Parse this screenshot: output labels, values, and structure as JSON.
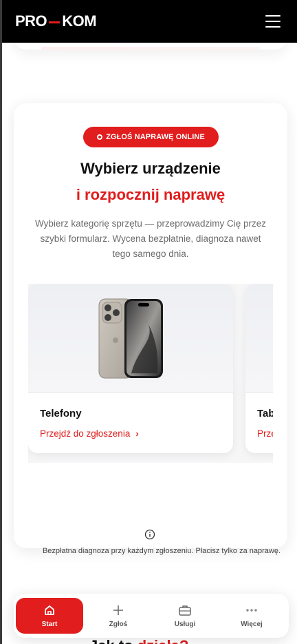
{
  "header": {
    "logo_left": "PRO",
    "logo_right": "KOM",
    "menu_icon": "hamburger-icon"
  },
  "card": {
    "badge": "ZGŁOŚ NAPRAWĘ ONLINE",
    "title_line1": "Wybierz urządzenie",
    "title_line2": "i rozpocznij naprawę",
    "description": "Wybierz kategorię sprzętu — przeprowadzimy Cię przez szybki formularz. Wycena bezpłatnie, diagnoza nawet tego samego dnia.",
    "categories": [
      {
        "name": "Telefony",
        "link": "Przejdź do zgłoszenia",
        "link_icon": "chevron-right-icon"
      },
      {
        "name": "Tab",
        "link": "Prze"
      }
    ],
    "note": "Bezpłatna diagnoza przy każdym zgłoszeniu. Płacisz tylko za naprawę."
  },
  "bottom_nav": {
    "items": [
      {
        "label": "Start",
        "icon": "home-icon",
        "active": true
      },
      {
        "label": "Zgłoś",
        "icon": "plus-icon"
      },
      {
        "label": "Usługi",
        "icon": "briefcase-icon"
      },
      {
        "label": "Więcej",
        "icon": "more-dots-icon"
      }
    ]
  },
  "peek": {
    "text_black": "Jak to",
    "text_red": "działa?"
  },
  "colors": {
    "accent": "#e11d1d",
    "topbar": "#000000"
  }
}
